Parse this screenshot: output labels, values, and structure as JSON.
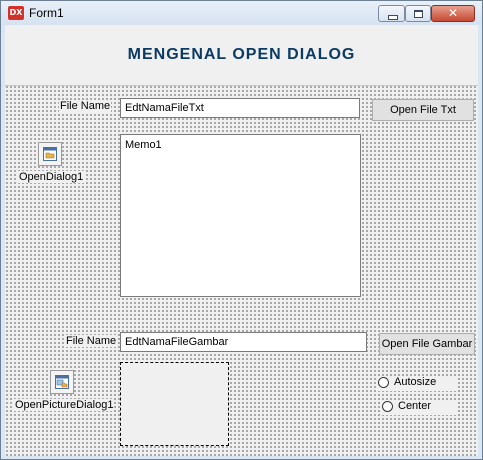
{
  "window": {
    "title": "Form1",
    "icon_text": "DX",
    "close_glyph": "✕"
  },
  "header": {
    "title": "MENGENAL OPEN DIALOG"
  },
  "text_section": {
    "file_name_label": "File Name",
    "file_name_value": "EdtNamaFileTxt",
    "open_button_label": "Open File Txt",
    "memo_text": "Memo1",
    "dialog_component_label": "OpenDialog1",
    "dialog_component_icon": "open-dialog-icon"
  },
  "image_section": {
    "file_name_label": "File Name",
    "file_name_value": "EdtNamaFileGambar",
    "open_button_label": "Open File Gambar",
    "dialog_component_label": "OpenPictureDialog1",
    "dialog_component_icon": "open-picture-dialog-icon",
    "options": [
      {
        "label": "Autosize",
        "checked": false
      },
      {
        "label": "Center",
        "checked": false
      }
    ]
  },
  "colors": {
    "header_title": "#0b3a63",
    "app_icon": "#d3312b",
    "close_button": "#c74a32"
  }
}
